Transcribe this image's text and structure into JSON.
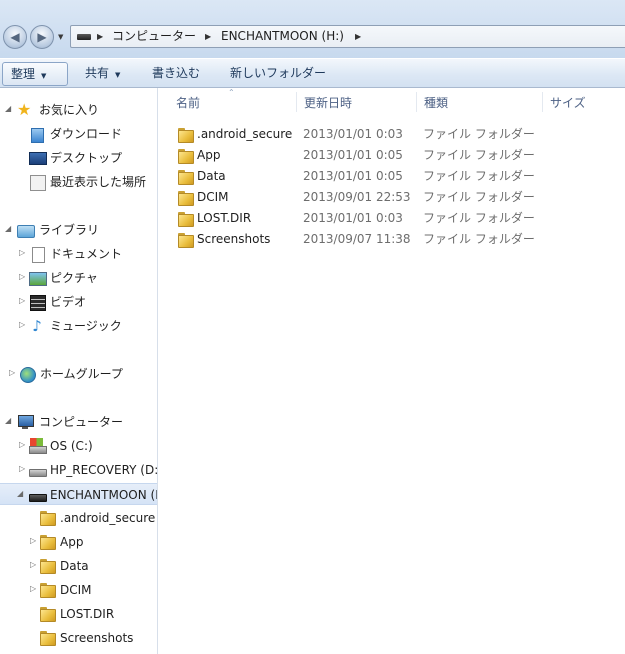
{
  "address": {
    "segments": [
      "コンピューター",
      "ENCHANTMOON (H:)"
    ]
  },
  "toolbar": {
    "organize": "整理",
    "share": "共有",
    "burn": "書き込む",
    "new_folder": "新しいフォルダー"
  },
  "nav": {
    "favorites": {
      "label": "お気に入り",
      "items": [
        "ダウンロード",
        "デスクトップ",
        "最近表示した場所"
      ]
    },
    "libraries": {
      "label": "ライブラリ",
      "items": [
        "ドキュメント",
        "ピクチャ",
        "ビデオ",
        "ミュージック"
      ]
    },
    "homegroup": "ホームグループ",
    "computer": {
      "label": "コンピューター",
      "drives": [
        "OS (C:)",
        "HP_RECOVERY (D:",
        "ENCHANTMOON (H"
      ],
      "subfolders": [
        ".android_secure",
        "App",
        "Data",
        "DCIM",
        "LOST.DIR",
        "Screenshots"
      ]
    }
  },
  "columns": {
    "name": "名前",
    "date": "更新日時",
    "type": "種類",
    "size": "サイズ"
  },
  "files": [
    {
      "name": ".android_secure",
      "date": "2013/01/01 0:03",
      "type": "ファイル フォルダー"
    },
    {
      "name": "App",
      "date": "2013/01/01 0:05",
      "type": "ファイル フォルダー"
    },
    {
      "name": "Data",
      "date": "2013/01/01 0:05",
      "type": "ファイル フォルダー"
    },
    {
      "name": "DCIM",
      "date": "2013/09/01 22:53",
      "type": "ファイル フォルダー"
    },
    {
      "name": "LOST.DIR",
      "date": "2013/01/01 0:03",
      "type": "ファイル フォルダー"
    },
    {
      "name": "Screenshots",
      "date": "2013/09/07 11:38",
      "type": "ファイル フォルダー"
    }
  ]
}
